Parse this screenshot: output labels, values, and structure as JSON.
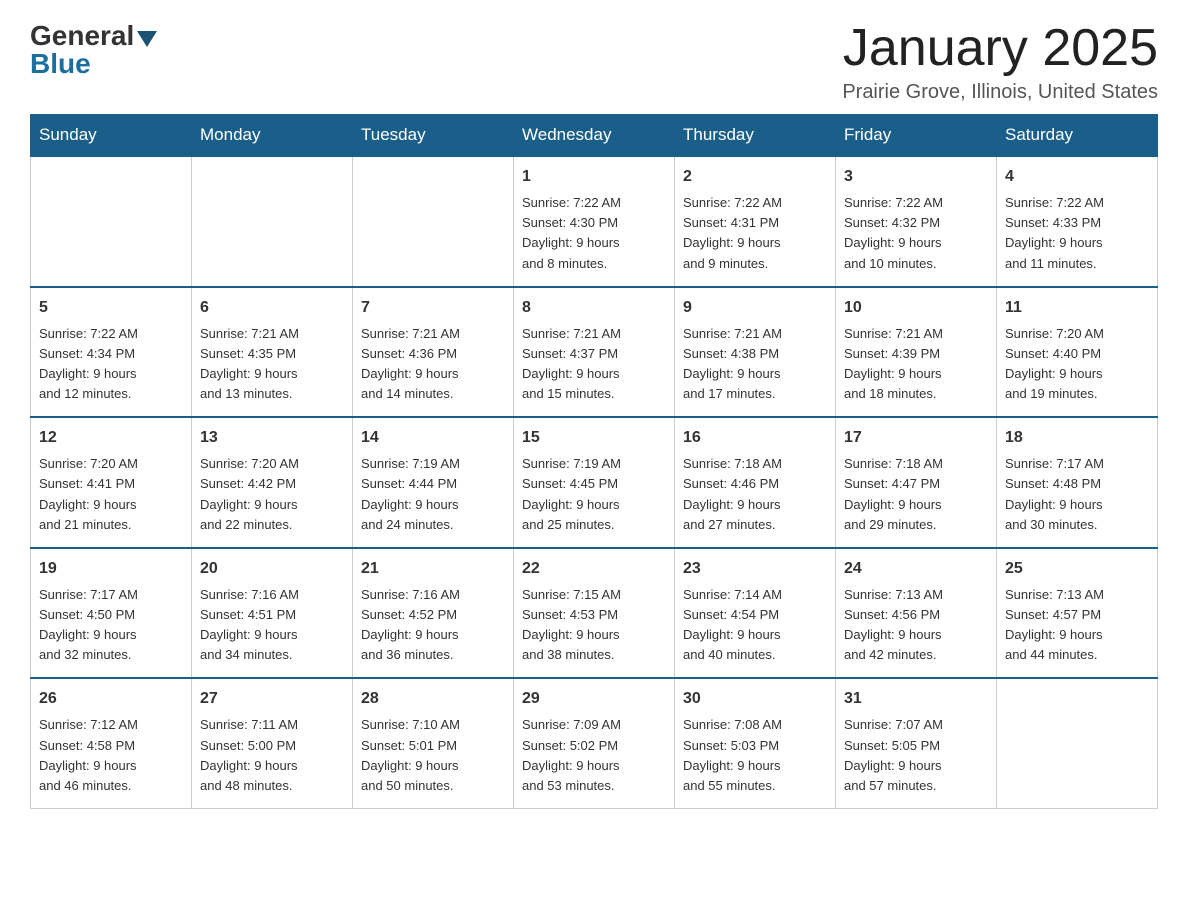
{
  "header": {
    "logo_general": "General",
    "logo_blue": "Blue",
    "month_title": "January 2025",
    "location": "Prairie Grove, Illinois, United States"
  },
  "days_of_week": [
    "Sunday",
    "Monday",
    "Tuesday",
    "Wednesday",
    "Thursday",
    "Friday",
    "Saturday"
  ],
  "weeks": [
    [
      {
        "day": "",
        "info": ""
      },
      {
        "day": "",
        "info": ""
      },
      {
        "day": "",
        "info": ""
      },
      {
        "day": "1",
        "info": "Sunrise: 7:22 AM\nSunset: 4:30 PM\nDaylight: 9 hours\nand 8 minutes."
      },
      {
        "day": "2",
        "info": "Sunrise: 7:22 AM\nSunset: 4:31 PM\nDaylight: 9 hours\nand 9 minutes."
      },
      {
        "day": "3",
        "info": "Sunrise: 7:22 AM\nSunset: 4:32 PM\nDaylight: 9 hours\nand 10 minutes."
      },
      {
        "day": "4",
        "info": "Sunrise: 7:22 AM\nSunset: 4:33 PM\nDaylight: 9 hours\nand 11 minutes."
      }
    ],
    [
      {
        "day": "5",
        "info": "Sunrise: 7:22 AM\nSunset: 4:34 PM\nDaylight: 9 hours\nand 12 minutes."
      },
      {
        "day": "6",
        "info": "Sunrise: 7:21 AM\nSunset: 4:35 PM\nDaylight: 9 hours\nand 13 minutes."
      },
      {
        "day": "7",
        "info": "Sunrise: 7:21 AM\nSunset: 4:36 PM\nDaylight: 9 hours\nand 14 minutes."
      },
      {
        "day": "8",
        "info": "Sunrise: 7:21 AM\nSunset: 4:37 PM\nDaylight: 9 hours\nand 15 minutes."
      },
      {
        "day": "9",
        "info": "Sunrise: 7:21 AM\nSunset: 4:38 PM\nDaylight: 9 hours\nand 17 minutes."
      },
      {
        "day": "10",
        "info": "Sunrise: 7:21 AM\nSunset: 4:39 PM\nDaylight: 9 hours\nand 18 minutes."
      },
      {
        "day": "11",
        "info": "Sunrise: 7:20 AM\nSunset: 4:40 PM\nDaylight: 9 hours\nand 19 minutes."
      }
    ],
    [
      {
        "day": "12",
        "info": "Sunrise: 7:20 AM\nSunset: 4:41 PM\nDaylight: 9 hours\nand 21 minutes."
      },
      {
        "day": "13",
        "info": "Sunrise: 7:20 AM\nSunset: 4:42 PM\nDaylight: 9 hours\nand 22 minutes."
      },
      {
        "day": "14",
        "info": "Sunrise: 7:19 AM\nSunset: 4:44 PM\nDaylight: 9 hours\nand 24 minutes."
      },
      {
        "day": "15",
        "info": "Sunrise: 7:19 AM\nSunset: 4:45 PM\nDaylight: 9 hours\nand 25 minutes."
      },
      {
        "day": "16",
        "info": "Sunrise: 7:18 AM\nSunset: 4:46 PM\nDaylight: 9 hours\nand 27 minutes."
      },
      {
        "day": "17",
        "info": "Sunrise: 7:18 AM\nSunset: 4:47 PM\nDaylight: 9 hours\nand 29 minutes."
      },
      {
        "day": "18",
        "info": "Sunrise: 7:17 AM\nSunset: 4:48 PM\nDaylight: 9 hours\nand 30 minutes."
      }
    ],
    [
      {
        "day": "19",
        "info": "Sunrise: 7:17 AM\nSunset: 4:50 PM\nDaylight: 9 hours\nand 32 minutes."
      },
      {
        "day": "20",
        "info": "Sunrise: 7:16 AM\nSunset: 4:51 PM\nDaylight: 9 hours\nand 34 minutes."
      },
      {
        "day": "21",
        "info": "Sunrise: 7:16 AM\nSunset: 4:52 PM\nDaylight: 9 hours\nand 36 minutes."
      },
      {
        "day": "22",
        "info": "Sunrise: 7:15 AM\nSunset: 4:53 PM\nDaylight: 9 hours\nand 38 minutes."
      },
      {
        "day": "23",
        "info": "Sunrise: 7:14 AM\nSunset: 4:54 PM\nDaylight: 9 hours\nand 40 minutes."
      },
      {
        "day": "24",
        "info": "Sunrise: 7:13 AM\nSunset: 4:56 PM\nDaylight: 9 hours\nand 42 minutes."
      },
      {
        "day": "25",
        "info": "Sunrise: 7:13 AM\nSunset: 4:57 PM\nDaylight: 9 hours\nand 44 minutes."
      }
    ],
    [
      {
        "day": "26",
        "info": "Sunrise: 7:12 AM\nSunset: 4:58 PM\nDaylight: 9 hours\nand 46 minutes."
      },
      {
        "day": "27",
        "info": "Sunrise: 7:11 AM\nSunset: 5:00 PM\nDaylight: 9 hours\nand 48 minutes."
      },
      {
        "day": "28",
        "info": "Sunrise: 7:10 AM\nSunset: 5:01 PM\nDaylight: 9 hours\nand 50 minutes."
      },
      {
        "day": "29",
        "info": "Sunrise: 7:09 AM\nSunset: 5:02 PM\nDaylight: 9 hours\nand 53 minutes."
      },
      {
        "day": "30",
        "info": "Sunrise: 7:08 AM\nSunset: 5:03 PM\nDaylight: 9 hours\nand 55 minutes."
      },
      {
        "day": "31",
        "info": "Sunrise: 7:07 AM\nSunset: 5:05 PM\nDaylight: 9 hours\nand 57 minutes."
      },
      {
        "day": "",
        "info": ""
      }
    ]
  ]
}
